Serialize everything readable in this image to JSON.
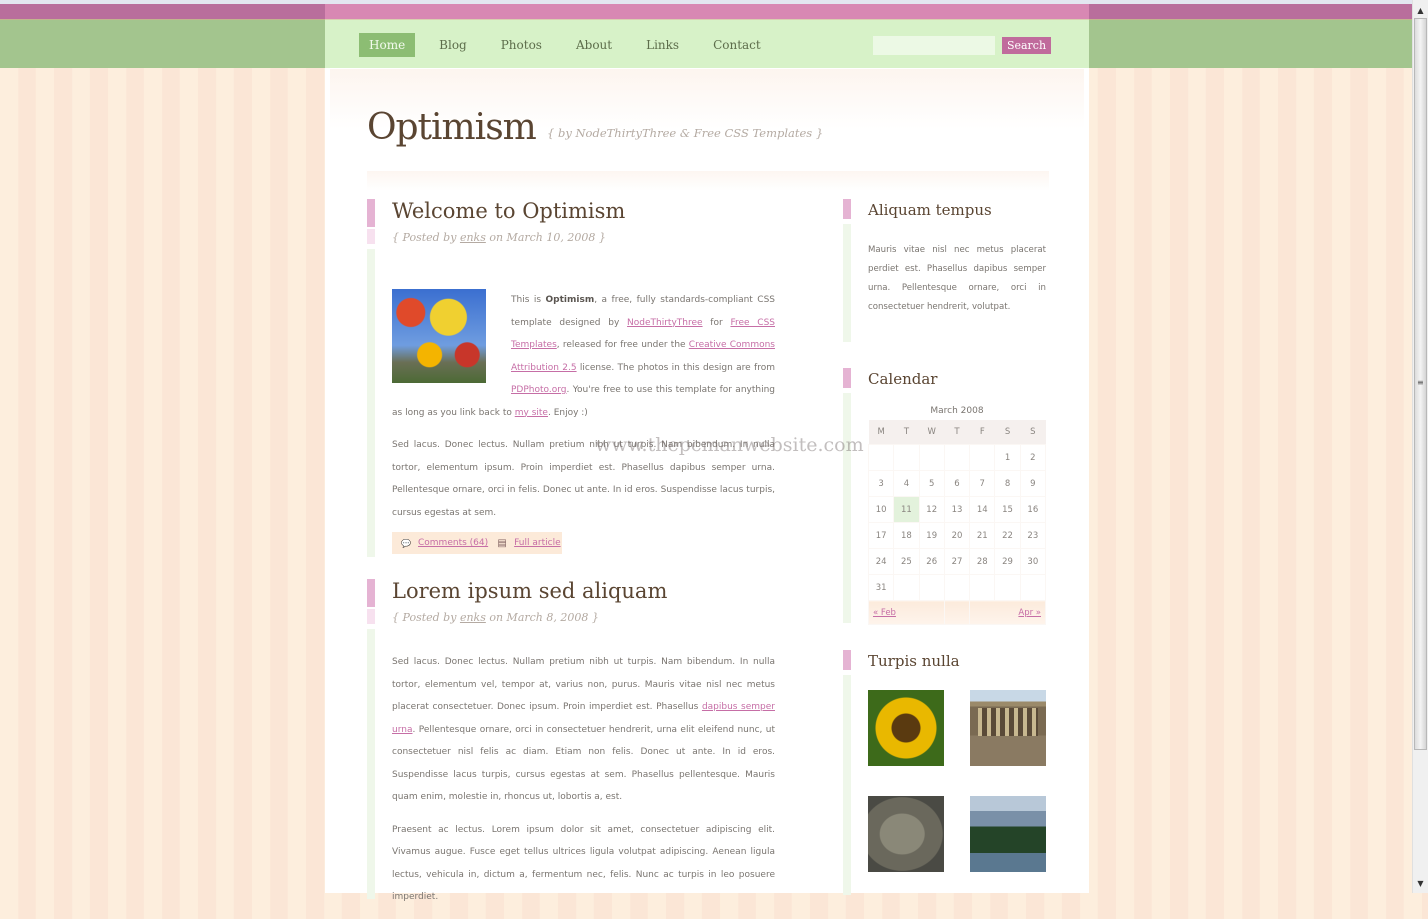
{
  "nav": {
    "items": [
      {
        "label": "Home",
        "active": true
      },
      {
        "label": "Blog"
      },
      {
        "label": "Photos"
      },
      {
        "label": "About"
      },
      {
        "label": "Links"
      },
      {
        "label": "Contact"
      }
    ],
    "search_value": "",
    "search_button": "Search"
  },
  "header": {
    "title": "Optimism",
    "tagline": "{ by NodeThirtyThree & Free CSS Templates }"
  },
  "posts": [
    {
      "title": "Welcome to Optimism",
      "meta_prefix": "{ Posted by ",
      "author": "enks",
      "meta_suffix": " on March 10, 2008 }",
      "image": "hot-air-balloons-photo",
      "intro": {
        "t1": "This is ",
        "strong": "Optimism",
        "t2": ", a free, fully standards-compliant CSS template designed by ",
        "link1": "NodeThirtyThree",
        "t3": " for ",
        "link2": "Free CSS Templates",
        "t4": ", released for free under the ",
        "link3": "Creative Commons Attribution 2.5",
        "t5": " license. The photos in this design are from ",
        "link4": "PDPhoto.org",
        "t6": ". You're free to use this template for anything as long as you link back to ",
        "link5": "my site",
        "t7": ". Enjoy :)"
      },
      "paragraph2": "Sed lacus. Donec lectus. Nullam pretium nibh ut turpis. Nam bibendum. In nulla tortor, elementum ipsum. Proin imperdiet est. Phasellus dapibus semper urna. Pellentesque ornare, orci in felis. Donec ut ante. In id eros. Suspendisse lacus turpis, cursus egestas at sem.",
      "comments_label": "Comments (64)",
      "full_article_label": "Full article"
    },
    {
      "title": "Lorem ipsum sed aliquam",
      "meta_prefix": "{ Posted by ",
      "author": "enks",
      "meta_suffix": " on March 8, 2008 }",
      "p1a": "Sed lacus. Donec lectus. Nullam pretium nibh ut turpis. Nam bibendum. In nulla tortor, elementum vel, tempor at, varius non, purus. Mauris vitae nisl nec metus placerat consectetuer. Donec ipsum. Proin imperdiet est. Phasellus ",
      "p1link": "dapibus semper urna",
      "p1b": ". Pellentesque ornare, orci in consectetuer hendrerit, urna elit eleifend nunc, ut consectetuer nisl felis ac diam. Etiam non felis. Donec ut ante. In id eros. Suspendisse lacus turpis, cursus egestas at sem. Phasellus pellentesque. Mauris quam enim, molestie in, rhoncus ut, lobortis a, est.",
      "p2": "Praesent ac lectus. Lorem ipsum dolor sit amet, consectetuer adipiscing elit. Vivamus augue. Fusce eget tellus ultrices ligula volutpat adipiscing. Aenean ligula lectus, vehicula in, dictum a, fermentum nec, felis. Nunc ac turpis in leo posuere imperdiet."
    }
  ],
  "sidebar": {
    "aliquam": {
      "title": "Aliquam tempus",
      "text": "Mauris vitae nisl nec metus placerat perdiet est. Phasellus dapibus semper urna. Pellentesque ornare, orci in consectetuer hendrerit, volutpat."
    },
    "calendar": {
      "title": "Calendar",
      "caption": "March 2008",
      "headers": [
        "M",
        "T",
        "W",
        "T",
        "F",
        "S",
        "S"
      ],
      "weeks": [
        [
          "",
          "",
          "",
          "",
          "",
          "1",
          "2"
        ],
        [
          "3",
          "4",
          "5",
          "6",
          "7",
          "8",
          "9"
        ],
        [
          "10",
          "11",
          "12",
          "13",
          "14",
          "15",
          "16"
        ],
        [
          "17",
          "18",
          "19",
          "20",
          "21",
          "22",
          "23"
        ],
        [
          "24",
          "25",
          "26",
          "27",
          "28",
          "29",
          "30"
        ],
        [
          "31",
          "",
          "",
          "",
          "",
          "",
          ""
        ]
      ],
      "today": "11",
      "prev": "« Feb",
      "next": "Apr »"
    },
    "photos": {
      "title": "Turpis nulla",
      "items": [
        "sunflower-photo",
        "museum-photo",
        "stone-face-photo",
        "mountain-lake-photo"
      ]
    }
  },
  "watermark": "www.thepcmanwebsite.com",
  "icons": {
    "comments": "💬",
    "article": "▤",
    "scroll_up": "▲",
    "scroll_down": "▼",
    "grip": "≡"
  }
}
